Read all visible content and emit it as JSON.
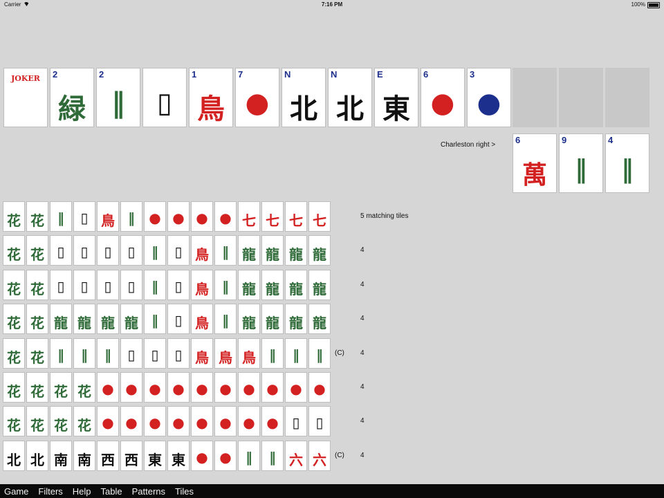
{
  "status_bar": {
    "carrier": "Carrier",
    "time": "7:16 PM",
    "battery": "100%"
  },
  "hand": {
    "tiles": [
      {
        "name": "joker-tile",
        "index": "",
        "glyph": "JOKER",
        "color": "#d32121"
      },
      {
        "name": "flower-tile",
        "index": "2",
        "glyph": "緑",
        "color": "#2f6b38"
      },
      {
        "name": "bam-2-tile",
        "index": "2",
        "glyph": "‖",
        "color": "#2f6b38"
      },
      {
        "name": "white-dragon-tile",
        "index": "",
        "glyph": "▯",
        "color": "#111111"
      },
      {
        "name": "bam-1-tile",
        "index": "1",
        "glyph": "鳥",
        "color": "#d32121"
      },
      {
        "name": "dot-7-tile",
        "index": "7",
        "glyph": "●",
        "color": "#d32121"
      },
      {
        "name": "north-wind-tile",
        "index": "N",
        "glyph": "北",
        "color": "#111111"
      },
      {
        "name": "north-wind-tile",
        "index": "N",
        "glyph": "北",
        "color": "#111111"
      },
      {
        "name": "east-wind-tile",
        "index": "E",
        "glyph": "東",
        "color": "#111111"
      },
      {
        "name": "dot-6-tile",
        "index": "6",
        "glyph": "●",
        "color": "#d32121"
      },
      {
        "name": "dot-3-tile",
        "index": "3",
        "glyph": "●",
        "color": "#1c2f8c"
      }
    ],
    "charleston_label": "Charleston right >",
    "passed_tiles": [
      {
        "name": "crak-6-tile",
        "index": "6",
        "glyph": "萬",
        "color": "#d32121"
      },
      {
        "name": "bam-9-tile",
        "index": "9",
        "glyph": "‖",
        "color": "#2f6b38"
      },
      {
        "name": "bam-4-tile",
        "index": "4",
        "glyph": "‖",
        "color": "#2f6b38"
      }
    ]
  },
  "patterns": [
    {
      "tiles": [
        "花",
        "花",
        "‖",
        "▯",
        "鳥",
        "‖",
        "●",
        "●",
        "●",
        "●",
        "七",
        "七",
        "七",
        "七"
      ],
      "note": "",
      "count": "5 matching tiles"
    },
    {
      "tiles": [
        "花",
        "花",
        "▯",
        "▯",
        "▯",
        "▯",
        "‖",
        "▯",
        "鳥",
        "‖",
        "龍",
        "龍",
        "龍",
        "龍"
      ],
      "note": "",
      "count": "4"
    },
    {
      "tiles": [
        "花",
        "花",
        "▯",
        "▯",
        "▯",
        "▯",
        "‖",
        "▯",
        "鳥",
        "‖",
        "龍",
        "龍",
        "龍",
        "龍"
      ],
      "note": "",
      "count": "4"
    },
    {
      "tiles": [
        "花",
        "花",
        "龍",
        "龍",
        "龍",
        "龍",
        "‖",
        "▯",
        "鳥",
        "‖",
        "龍",
        "龍",
        "龍",
        "龍"
      ],
      "note": "",
      "count": "4"
    },
    {
      "tiles": [
        "花",
        "花",
        "‖",
        "‖",
        "‖",
        "▯",
        "▯",
        "▯",
        "鳥",
        "鳥",
        "鳥",
        "‖",
        "‖",
        "‖"
      ],
      "note": "(C)",
      "count": "4"
    },
    {
      "tiles": [
        "花",
        "花",
        "花",
        "花",
        "●",
        "●",
        "●",
        "●",
        "●",
        "●",
        "●",
        "●",
        "●",
        "●"
      ],
      "note": "",
      "count": "4"
    },
    {
      "tiles": [
        "花",
        "花",
        "花",
        "花",
        "●",
        "●",
        "●",
        "●",
        "●",
        "●",
        "●",
        "●",
        "▯",
        "▯"
      ],
      "note": "",
      "count": "4"
    },
    {
      "tiles": [
        "北",
        "北",
        "南",
        "南",
        "西",
        "西",
        "東",
        "東",
        "●",
        "●",
        "‖",
        "‖",
        "六",
        "六"
      ],
      "note": "(C)",
      "count": "4"
    }
  ],
  "menu": [
    "Game",
    "Filters",
    "Help",
    "Table",
    "Patterns",
    "Tiles"
  ]
}
